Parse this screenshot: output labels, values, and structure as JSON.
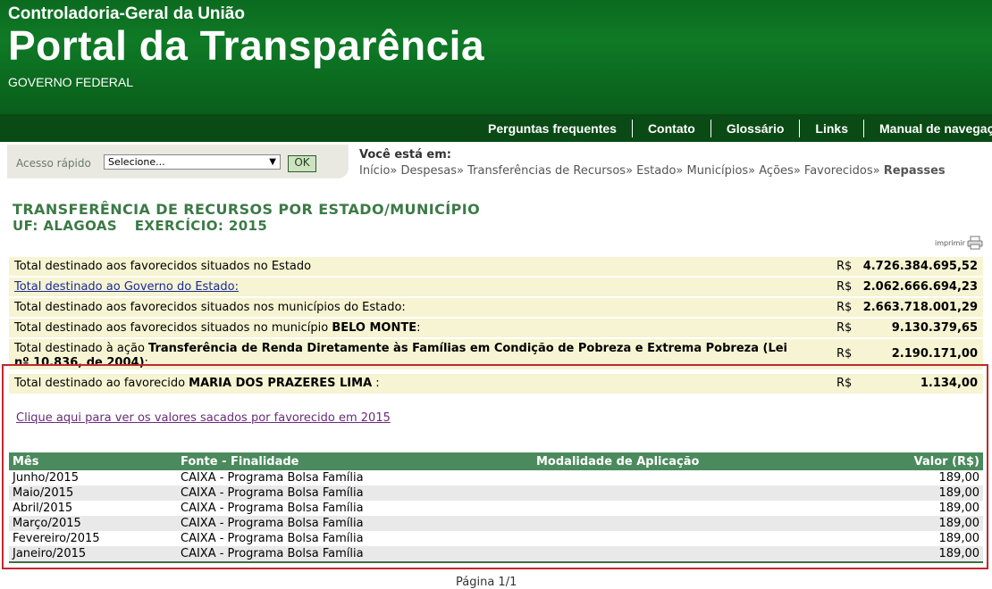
{
  "header": {
    "org": "Controladoria-Geral da União",
    "title": "Portal da Transparência",
    "gov": "GOVERNO FEDERAL"
  },
  "nav": [
    "Perguntas frequentes",
    "Contato",
    "Glossário",
    "Links",
    "Manual de navegação"
  ],
  "quick_access": {
    "label": "Acesso rápido",
    "select_value": "Selecione...",
    "ok_label": "OK"
  },
  "breadcrumb": {
    "heading": "Você está em:",
    "items": [
      "Início",
      "Despesas",
      "Transferências de Recursos",
      "Estado",
      "Municípios",
      "Ações",
      "Favorecidos"
    ],
    "current": "Repasses"
  },
  "title": "TRANSFERÊNCIA DE RECURSOS POR ESTADO/MUNICÍPIO",
  "subtitle": {
    "uf": "UF: ALAGOAS",
    "exercicio": "EXERCÍCIO: 2015"
  },
  "print_label": "imprimir",
  "summary": [
    {
      "label": "Total destinado aos favorecidos situados no Estado",
      "currency": "R$",
      "value": "4.726.384.695,52"
    },
    {
      "label": "Total destinado ao Governo do Estado:",
      "currency": "R$",
      "value": "2.062.666.694,23"
    },
    {
      "label": "Total destinado aos favorecidos situados nos municípios do Estado:",
      "currency": "R$",
      "value": "2.663.718.001,29"
    },
    {
      "label": "Total destinado aos favorecidos situados no município ",
      "label_bold": "BELO MONTE",
      "label_tail": ":",
      "currency": "R$",
      "value": "9.130.379,65"
    },
    {
      "label": "Total destinado à ação ",
      "label_bold": "Transferência de Renda Diretamente às Famílias em Condição de Pobreza e Extrema Pobreza (Lei nº 10.836, de 2004)",
      "label_tail": ":",
      "currency": "R$",
      "value": "2.190.171,00"
    },
    {
      "label": "Total destinado ao favorecido ",
      "label_bold": "MARIA DOS PRAZERES LIMA",
      "label_tail": " :",
      "currency": "R$",
      "value": "1.134,00"
    }
  ],
  "link_saques": "Clique aqui para ver os valores sacados por favorecido em 2015",
  "table": {
    "headers": [
      "Mês",
      "Fonte - Finalidade",
      "Modalidade de Aplicação",
      "Valor (R$)"
    ],
    "rows": [
      [
        "Junho/2015",
        "CAIXA - Programa Bolsa Família",
        "",
        "189,00"
      ],
      [
        "Maio/2015",
        "CAIXA - Programa Bolsa Família",
        "",
        "189,00"
      ],
      [
        "Abril/2015",
        "CAIXA - Programa Bolsa Família",
        "",
        "189,00"
      ],
      [
        "Março/2015",
        "CAIXA - Programa Bolsa Família",
        "",
        "189,00"
      ],
      [
        "Fevereiro/2015",
        "CAIXA - Programa Bolsa Família",
        "",
        "189,00"
      ],
      [
        "Janeiro/2015",
        "CAIXA - Programa Bolsa Família",
        "",
        "189,00"
      ]
    ]
  },
  "footer": "Página 1/1"
}
